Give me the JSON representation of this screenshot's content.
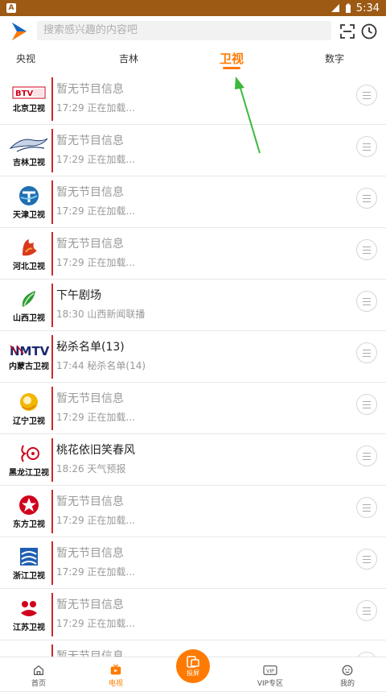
{
  "status_bar": {
    "time": "5:34",
    "notification": "A"
  },
  "search": {
    "placeholder": "搜索感兴趣的内容吧"
  },
  "tabs": [
    {
      "label": "央视",
      "active": false
    },
    {
      "label": "吉林",
      "active": false
    },
    {
      "label": "卫视",
      "active": true
    },
    {
      "label": "数字",
      "active": false
    }
  ],
  "channels": [
    {
      "name": "北京卫视",
      "logo_text": "BTV",
      "title": "暂无节目信息",
      "subtitle": "17:29  正在加载...",
      "has_program": false,
      "accent": "#d0021b"
    },
    {
      "name": "吉林卫视",
      "logo_text": "",
      "title": "暂无节目信息",
      "subtitle": "17:29  正在加载...",
      "has_program": false,
      "accent": "#1a3a6e"
    },
    {
      "name": "天津卫视",
      "logo_text": "",
      "title": "暂无节目信息",
      "subtitle": "17:29  正在加载...",
      "has_program": false,
      "accent": "#1f6fb2"
    },
    {
      "name": "河北卫视",
      "logo_text": "",
      "title": "暂无节目信息",
      "subtitle": "17:29  正在加载...",
      "has_program": false,
      "accent": "#d9381e"
    },
    {
      "name": "山西卫视",
      "logo_text": "",
      "title": "下午剧场",
      "subtitle": "18:30  山西新闻联播",
      "has_program": true,
      "accent": "#2e9c3a"
    },
    {
      "name": "内蒙古卫视",
      "logo_text": "NMTV",
      "title": "秘杀名单(13)",
      "subtitle": "17:44  秘杀名单(14)",
      "has_program": true,
      "accent": "#1b2a6e"
    },
    {
      "name": "辽宁卫视",
      "logo_text": "",
      "title": "暂无节目信息",
      "subtitle": "17:29  正在加载...",
      "has_program": false,
      "accent": "#e6a800"
    },
    {
      "name": "黑龙江卫视",
      "logo_text": "",
      "title": "桃花依旧笑春风",
      "subtitle": "18:26  天气预报",
      "has_program": true,
      "accent": "#d0021b"
    },
    {
      "name": "东方卫视",
      "logo_text": "",
      "title": "暂无节目信息",
      "subtitle": "17:29  正在加载...",
      "has_program": false,
      "accent": "#d0021b"
    },
    {
      "name": "浙江卫视",
      "logo_text": "",
      "title": "暂无节目信息",
      "subtitle": "17:29  正在加载...",
      "has_program": false,
      "accent": "#1f5fb2"
    },
    {
      "name": "江苏卫视",
      "logo_text": "",
      "title": "暂无节目信息",
      "subtitle": "17:29  正在加载...",
      "has_program": false,
      "accent": "#d0021b"
    },
    {
      "name": "",
      "logo_text": "",
      "title": "暂无节目信息",
      "subtitle": "",
      "has_program": false,
      "accent": "#d0021b"
    }
  ],
  "bottom_nav": [
    {
      "label": "首页",
      "icon": "home-icon",
      "active": false
    },
    {
      "label": "电视",
      "icon": "tv-icon",
      "active": true
    },
    {
      "label": "投屏",
      "icon": "cast-icon",
      "active": false,
      "center": true
    },
    {
      "label": "VIP专区",
      "icon": "vip-icon",
      "active": false
    },
    {
      "label": "我的",
      "icon": "profile-icon",
      "active": false
    }
  ],
  "colors": {
    "accent": "#ff7a00",
    "status_bar": "#9c5a14",
    "divider": "#c92a2a",
    "annotation_arrow": "#3cb83c"
  }
}
